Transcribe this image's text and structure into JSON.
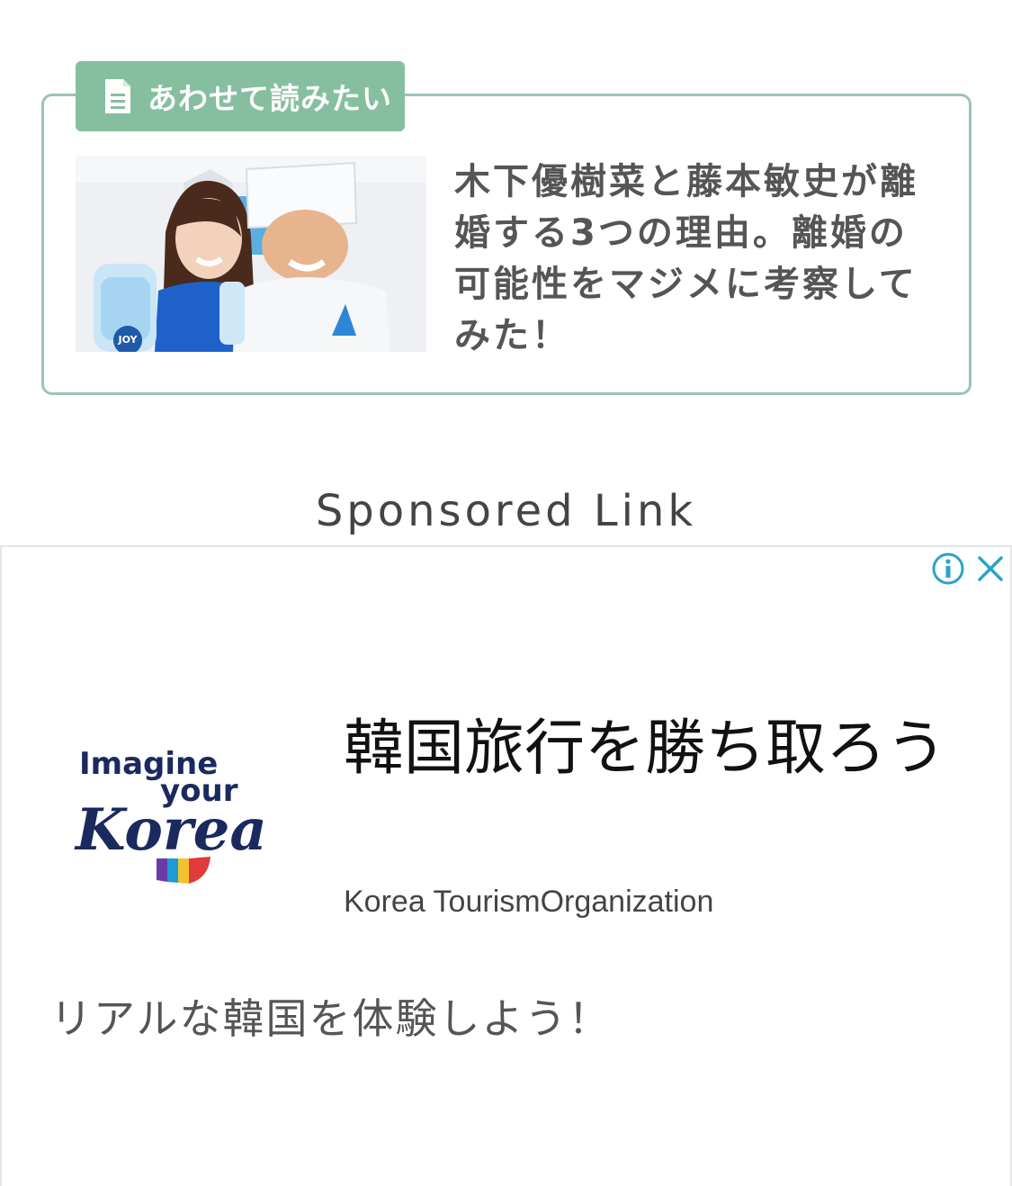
{
  "related": {
    "tab_label": "あわせて読みたい",
    "tab_icon": "document-icon",
    "title": "木下優樹菜と藤本敏史が離婚する3つの理由。離婚の可能性をマジメに考察してみた！",
    "thumbnail_logo_text": "JOY",
    "accent_color": "#86bfa0",
    "border_color": "#9ec2bd"
  },
  "sponsored": {
    "label": "Sponsored Link"
  },
  "ad": {
    "info_icon": "info-icon",
    "close_icon": "close-icon",
    "logo_lines": [
      "Imagine",
      "your",
      "Korea"
    ],
    "headline": "韓国旅行を勝ち取ろう",
    "advertiser": "Korea TourismOrganization",
    "description": "リアルな韓国を体験しよう！",
    "icon_color": "#2aa3c9",
    "logo_color": "#1a2a5e"
  }
}
